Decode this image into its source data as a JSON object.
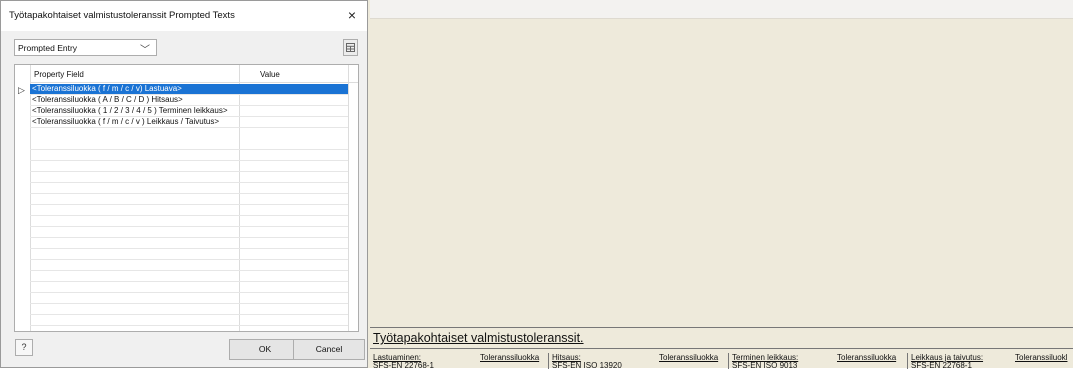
{
  "dialog": {
    "title": "Työtapakohtaiset valmistustoleranssit Prompted Texts",
    "close_glyph": "×",
    "mode_select": {
      "value": "Prompted Entry",
      "chevron_glyph": "﹀"
    },
    "table_icon": "table-icon",
    "grid": {
      "columns": [
        "Property Field",
        "Value"
      ],
      "rows": [
        {
          "field": "<Toleranssiluokka ( f / m / c / v) Lastuava>",
          "value": "",
          "selected": true
        },
        {
          "field": "<Toleranssiluokka ( A / B / C / D ) Hitsaus>",
          "value": "",
          "selected": false
        },
        {
          "field": "<Toleranssiluokka ( 1 / 2 / 3 / 4 / 5 ) Terminen leikkaus>",
          "value": "",
          "selected": false
        },
        {
          "field": "<Toleranssiluokka ( f / m / c / v ) Leikkaus / Taivutus>",
          "value": "",
          "selected": false
        }
      ],
      "row_pointer_glyph": "▷"
    },
    "help_glyph": "?",
    "ok_label": "OK",
    "cancel_label": "Cancel"
  },
  "title_block": {
    "title": "Työtapakohtaiset valmistustoleranssit.",
    "sections": [
      {
        "label": "Lastuaminen:",
        "class_label": "Toleranssiluokka",
        "standard": "SFS-EN 22768-1"
      },
      {
        "label": "Hitsaus:",
        "class_label": "Toleranssiluokka",
        "standard": "SFS-EN ISO 13920"
      },
      {
        "label": "Terminen leikkaus:",
        "class_label": "Toleranssiluokka",
        "standard": "SFS-EN ISO 9013"
      },
      {
        "label": "Leikkaus ja taivutus:",
        "class_label": "Toleranssiluokl",
        "standard": "SFS-EN 22768-1"
      }
    ]
  },
  "colors": {
    "selection": "#1a73d4",
    "canvas": "#eeeadb"
  }
}
